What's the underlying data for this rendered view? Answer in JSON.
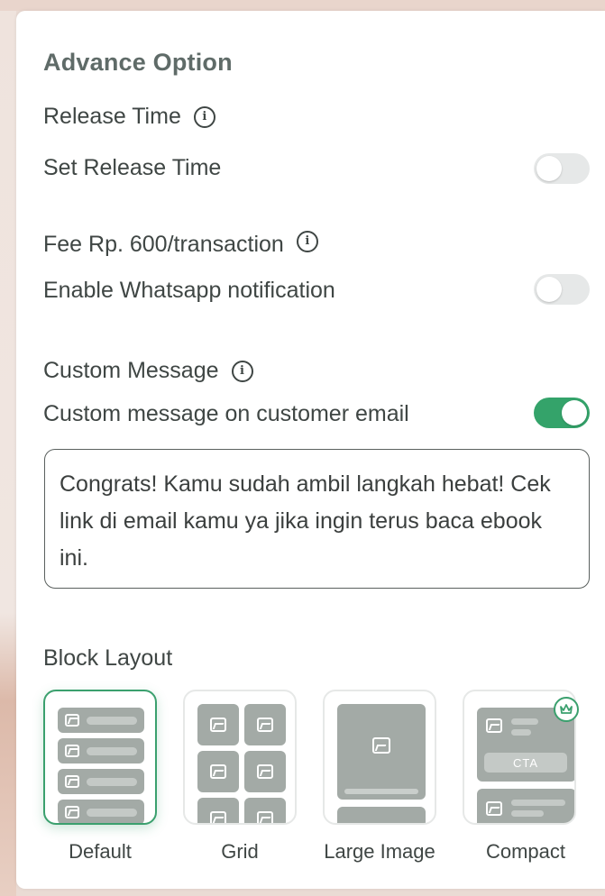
{
  "section": {
    "title": "Advance Option"
  },
  "release": {
    "label": "Release Time",
    "setting_label": "Set Release Time",
    "toggle_on": false
  },
  "whatsapp": {
    "label": "Fee Rp. 600/transaction",
    "setting_label": "Enable Whatsapp notification",
    "toggle_on": false
  },
  "custom_message": {
    "label": "Custom Message",
    "setting_label": "Custom message on customer email",
    "toggle_on": true,
    "value": "Congrats! Kamu sudah ambil langkah hebat! Cek link di email kamu ya jika ingin terus baca ebook ini."
  },
  "block_layout": {
    "label": "Block Layout",
    "selected": "Default",
    "options": [
      {
        "name": "Default"
      },
      {
        "name": "Grid"
      },
      {
        "name": "Large Image"
      },
      {
        "name": "Compact",
        "cta_text": "CTA"
      }
    ]
  },
  "icons": {
    "info": "info-circle-icon",
    "image": "image-icon",
    "crown": "crown-icon"
  },
  "colors": {
    "accent_green": "#34a36a",
    "placeholder_gray": "#a3aaa6"
  }
}
